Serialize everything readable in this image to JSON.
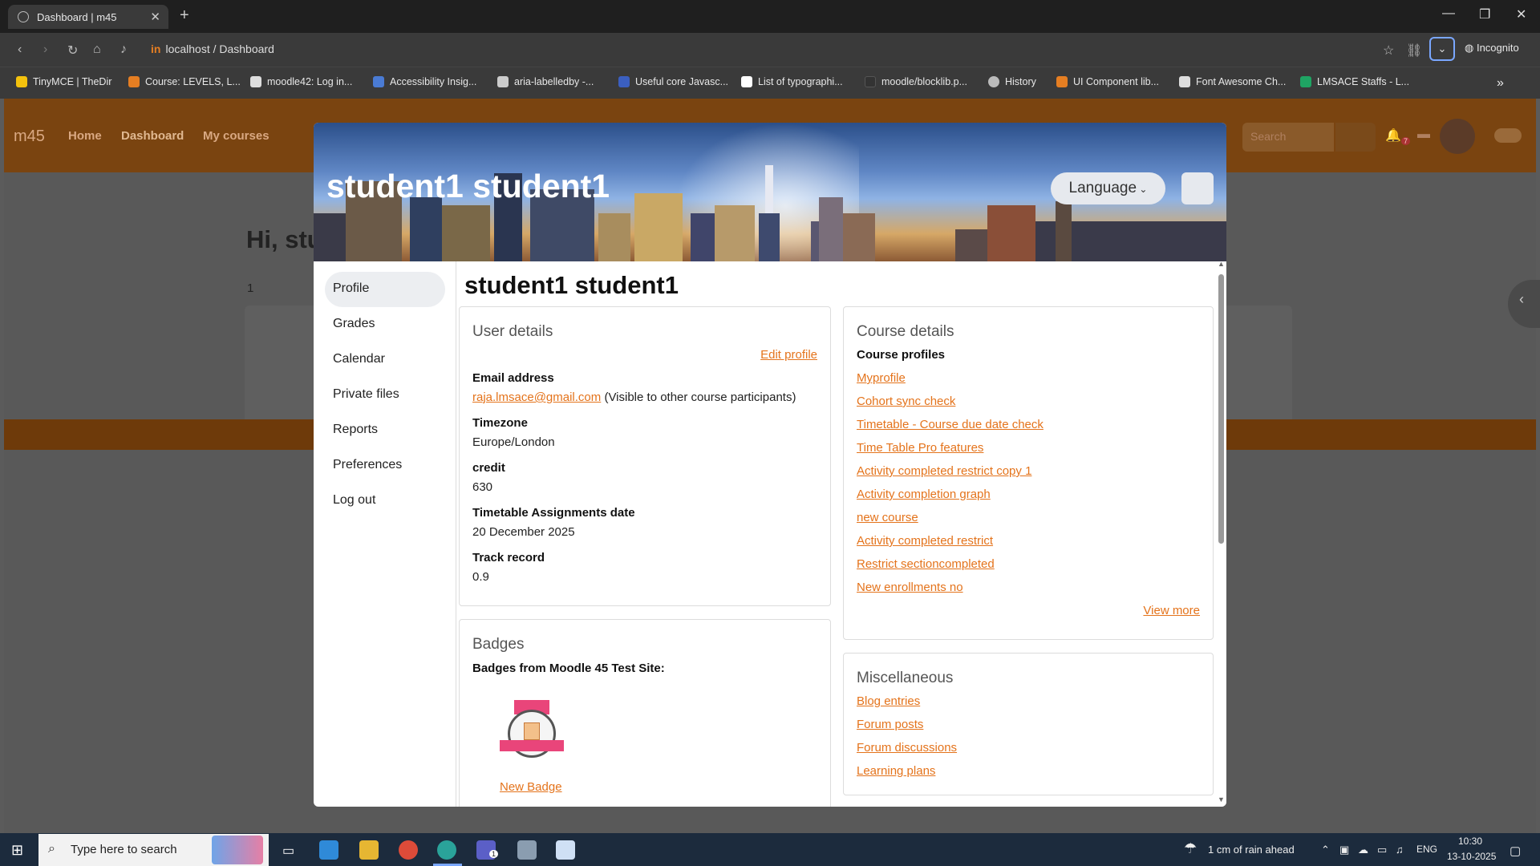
{
  "browser": {
    "tab_title": "Dashboard | m45",
    "url_prefix": "in",
    "url": "localhost / Dashboard",
    "incognito_label": "Incognito",
    "bookmarks": [
      {
        "label": "TinyMCE | TheDir",
        "color": "#f4c20d"
      },
      {
        "label": "Course: LEVELS, L...",
        "color": "#e57e22"
      },
      {
        "label": "moodle42: Log in...",
        "color": "#dddddd"
      },
      {
        "label": "Accessibility Insig...",
        "color": "#4a7bd4"
      },
      {
        "label": "aria-labelledby -...",
        "color": "#cccccc"
      },
      {
        "label": "Useful core Javasc...",
        "color": "#3b5fc0"
      },
      {
        "label": "List of typographi...",
        "color": "#ffffff"
      },
      {
        "label": "moodle/blocklib.p...",
        "color": "#333333"
      },
      {
        "label": "History",
        "color": "#bbbbbb"
      },
      {
        "label": "UI Component lib...",
        "color": "#e57e22"
      },
      {
        "label": "Font Awesome Ch...",
        "color": "#dddddd"
      },
      {
        "label": "LMSACE Staffs - L...",
        "color": "#1fa463"
      }
    ]
  },
  "site": {
    "brand": "m45",
    "nav": [
      "Home",
      "Dashboard",
      "My courses"
    ],
    "search_placeholder": "Search",
    "greeting": "Hi, stu",
    "count": "1",
    "notification_count": "7"
  },
  "modal": {
    "header_name": "student1 student1",
    "language_label": "Language",
    "page_title": "student1 student1",
    "sidebar": [
      "Profile",
      "Grades",
      "Calendar",
      "Private files",
      "Reports",
      "Preferences",
      "Log out"
    ],
    "user_details": {
      "heading": "User details",
      "edit_profile": "Edit profile",
      "email_label": "Email address",
      "email": "raja.lmsace@gmail.com",
      "email_note": " (Visible to other course participants)",
      "timezone_label": "Timezone",
      "timezone": "Europe/London",
      "credit_label": "credit",
      "credit": "630",
      "timetable_label": "Timetable Assignments date",
      "timetable": "20 December 2025",
      "track_label": "Track record",
      "track": "0.9"
    },
    "badges": {
      "heading": "Badges",
      "subheading": "Badges from Moodle 45 Test Site:",
      "badge_name": "New Badge"
    },
    "course_details": {
      "heading": "Course details",
      "subheading": "Course profiles",
      "courses": [
        "Myprofile",
        "Cohort sync check",
        "Timetable - Course due date check",
        "Time Table Pro features",
        "Activity completed restrict copy 1",
        "Activity completion graph",
        "new course",
        "Activity completed restrict",
        "Restrict sectioncompleted",
        "New enrollments no"
      ],
      "view_more": "View more"
    },
    "misc": {
      "heading": "Miscellaneous",
      "links": [
        "Blog entries",
        "Forum posts",
        "Forum discussions",
        "Learning plans"
      ]
    }
  },
  "taskbar": {
    "search_placeholder": "Type here to search",
    "weather": "1 cm of rain ahead",
    "lang": "ENG",
    "time": "10:30",
    "date": "13-10-2025",
    "teams_badge": "1"
  },
  "colors": {
    "accent": "#e4731b",
    "nav": "#7a4410"
  }
}
